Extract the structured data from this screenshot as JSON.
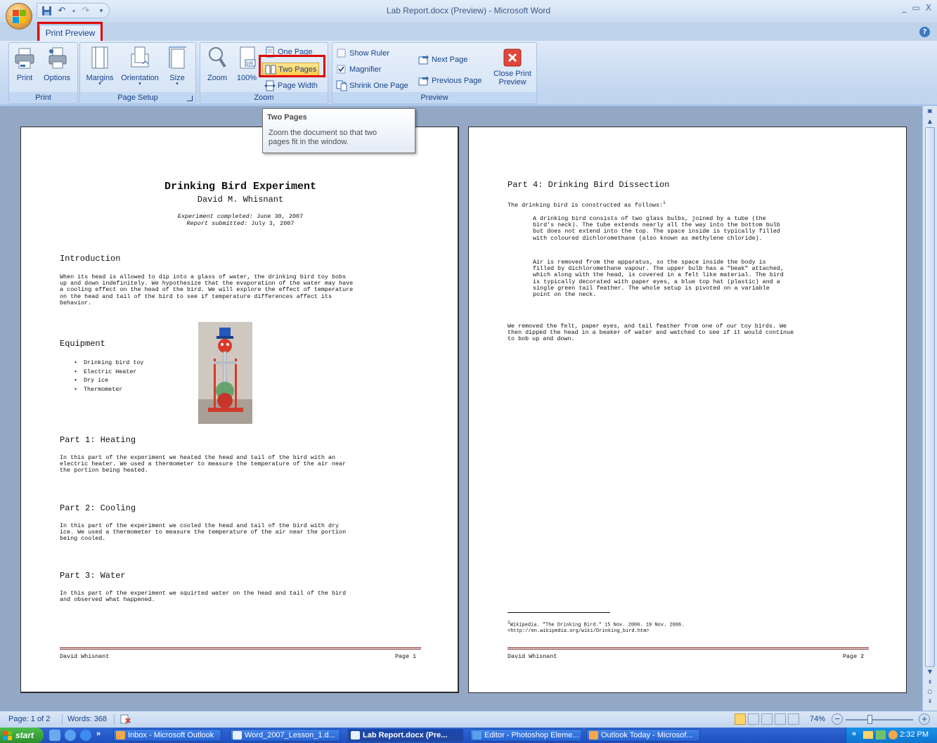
{
  "window": {
    "title": "Lab Report.docx (Preview) - Microsoft Word",
    "controls": [
      "_",
      "▭",
      "X"
    ]
  },
  "tabs": {
    "active": "Print Preview"
  },
  "ribbon": {
    "groups": {
      "print": {
        "label": "Print",
        "print": "Print",
        "options": "Options"
      },
      "page_setup": {
        "label": "Page Setup",
        "margins": "Margins",
        "orientation": "Orientation",
        "size": "Size"
      },
      "zoom": {
        "label": "Zoom",
        "zoom": "Zoom",
        "hundred": "100%",
        "one_page": "One Page",
        "two_pages": "Two Pages",
        "page_width": "Page Width"
      },
      "preview": {
        "label": "Preview",
        "show_ruler": "Show Ruler",
        "magnifier": "Magnifier",
        "shrink_one_page": "Shrink One Page",
        "next_page": "Next Page",
        "previous_page": "Previous Page",
        "close_print_preview_1": "Close Print",
        "close_print_preview_2": "Preview"
      }
    },
    "checks": {
      "show_ruler": false,
      "magnifier": true
    }
  },
  "tooltip": {
    "title": "Two Pages",
    "body_1": "Zoom the document so that two",
    "body_2": "pages fit in the window."
  },
  "page1": {
    "title": "Drinking Bird Experiment",
    "author": "David M. Whisnant",
    "completed_label": "Experiment completed:",
    "completed_date": "June 30, 2007",
    "submitted_label": "Report submitted:",
    "submitted_date": "July 3, 2007",
    "intro_heading": "Introduction",
    "intro_text": "When its head is allowed to dip into a glass of water, the drinking bird toy bobs\nup and down indefinitely. We hypothesize that the evaporation of the water may have\na cooling effect on the head of the bird. We will explore the effect of temperature\non the head and tail of the bird to see if temperature differences affect its\nbehavior.",
    "equipment_heading": "Equipment",
    "equipment": [
      "Drinking bird toy",
      "Electric Heater",
      "Dry ice",
      "Thermometer"
    ],
    "part1_heading": "Part 1: Heating",
    "part1_text": "In this part of the experiment we heated the head and tail of the bird with an\nelectric heater. We used a thermometer to measure the temperature of the air near\nthe portion being heated.",
    "part2_heading": "Part 2: Cooling",
    "part2_text": "In this part of the experiment we cooled the head and tail of the bird with dry\nice. We used a thermometer to measure the temperature of the air near the portion\nbeing cooled.",
    "part3_heading": "Part 3: Water",
    "part3_text": "In this part of the experiment we squirted water on the head and tail of the bird\nand observed what happened.",
    "footer_left": "David Whisnant",
    "footer_right": "Page 1"
  },
  "page2": {
    "part4_heading": "Part 4: Drinking Bird Dissection",
    "lead": "The drinking bird is constructed as follows:",
    "lead_fn": "1",
    "quote1": "A drinking bird consists of two glass bulbs, joined by a tube (the\nbird's neck). The tube extends nearly all the way into the bottom bulb\nbut does not extend into the top. The space inside is typically filled\nwith coloured dichloromethane (also known as methylene chloride).",
    "quote2": "Air is removed from the apparatus, so the space inside the body is\nfilled by dichloromethane vapour. The upper bulb has a \"beak\" attached,\nwhich along with the head, is covered in a felt like material. The bird\nis typically decorated with paper eyes, a blue top hat (plastic) and a\nsingle green tail feather. The whole setup is pivoted on a variable\npoint on the neck.",
    "para": "We removed the felt, paper eyes, and tail feather from one of our toy birds. We\nthen dipped the head in a beaker of water and watched to see if it would continue\nto bob up and down.",
    "footnote_num": "1",
    "footnote": "Wikipedia. \"The Drinking Bird.\" 15 Nov. 2006. 19 Nov. 2006.\n<http://en.wikipedia.org/wiki/Drinking_bird.htm>",
    "footer_left": "David Whisnant",
    "footer_right": "Page 2"
  },
  "statusbar": {
    "page": "Page: 1 of 2",
    "words": "Words: 368",
    "zoom": "74%"
  },
  "taskbar": {
    "start": "start",
    "items": [
      "Inbox - Microsoft Outlook",
      "Word_2007_Lesson_1.d...",
      "Lab Report.docx (Pre...",
      "Editor - Photoshop Eleme...",
      "Outlook Today - Microsof..."
    ],
    "clock": "2:32 PM",
    "chevron": "»",
    "tray_chevron": "«"
  },
  "colors": {
    "ribbon_bg": "#c5d8f0",
    "highlight": "#e00000",
    "doc_area": "#92a8c5",
    "footer_rule": "#7b2b2b"
  }
}
